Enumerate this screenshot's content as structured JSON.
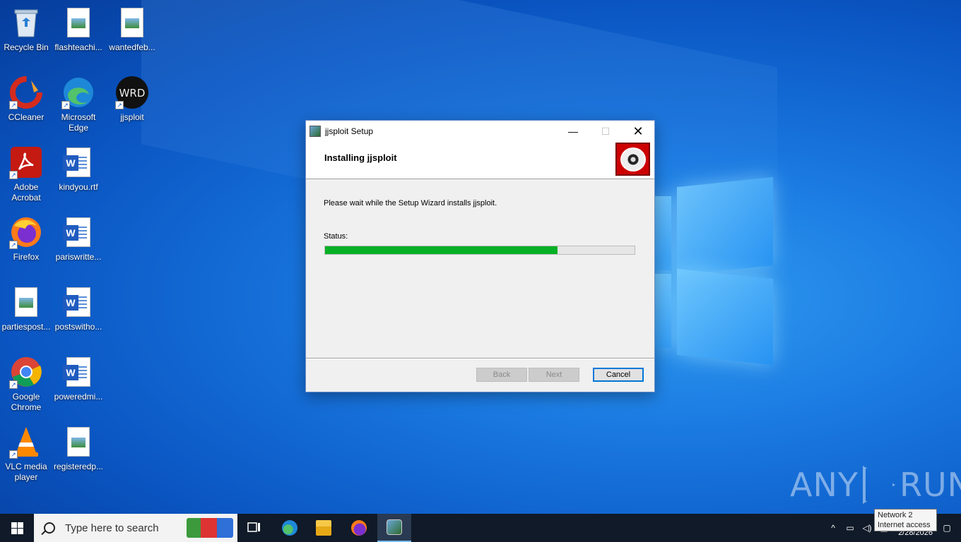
{
  "desktop": {
    "icons": [
      {
        "label": "Recycle Bin"
      },
      {
        "label": "flashteachi..."
      },
      {
        "label": "wantedfeb..."
      },
      {
        "label": "CCleaner"
      },
      {
        "label": "Microsoft Edge"
      },
      {
        "label": "jjsploit"
      },
      {
        "label": "Adobe Acrobat"
      },
      {
        "label": "kindyou.rtf"
      },
      {
        "label": "Firefox"
      },
      {
        "label": "pariswritte..."
      },
      {
        "label": "partiespost..."
      },
      {
        "label": "postswitho..."
      },
      {
        "label": "Google Chrome"
      },
      {
        "label": "poweredmi..."
      },
      {
        "label": "VLC media player"
      },
      {
        "label": "registeredp..."
      }
    ]
  },
  "dialog": {
    "title": "jjsploit Setup",
    "heading": "Installing jjsploit",
    "description": "Please wait while the Setup Wizard installs jjsploit.",
    "status_label": "Status:",
    "progress_fraction": 0.75,
    "buttons": {
      "back": "Back",
      "next": "Next",
      "cancel": "Cancel"
    },
    "controls": {
      "minimize": "—",
      "maximize": "☐",
      "close": "✕"
    }
  },
  "watermark": {
    "left": "ANY",
    "right": "RUN"
  },
  "taskbar": {
    "search_placeholder": "Type here to search",
    "pinned": [
      "task-view-icon",
      "edge-icon",
      "file-explorer-icon",
      "firefox-icon",
      "jjsploit-setup-icon"
    ],
    "tray": {
      "chevron": "^",
      "clock_date": "2/28/2026"
    },
    "tooltip": {
      "line1": "Network 2",
      "line2": "Internet access"
    }
  },
  "colors": {
    "progress": "#06b025",
    "taskbar": "#101a28",
    "accent": "#0078d7"
  }
}
